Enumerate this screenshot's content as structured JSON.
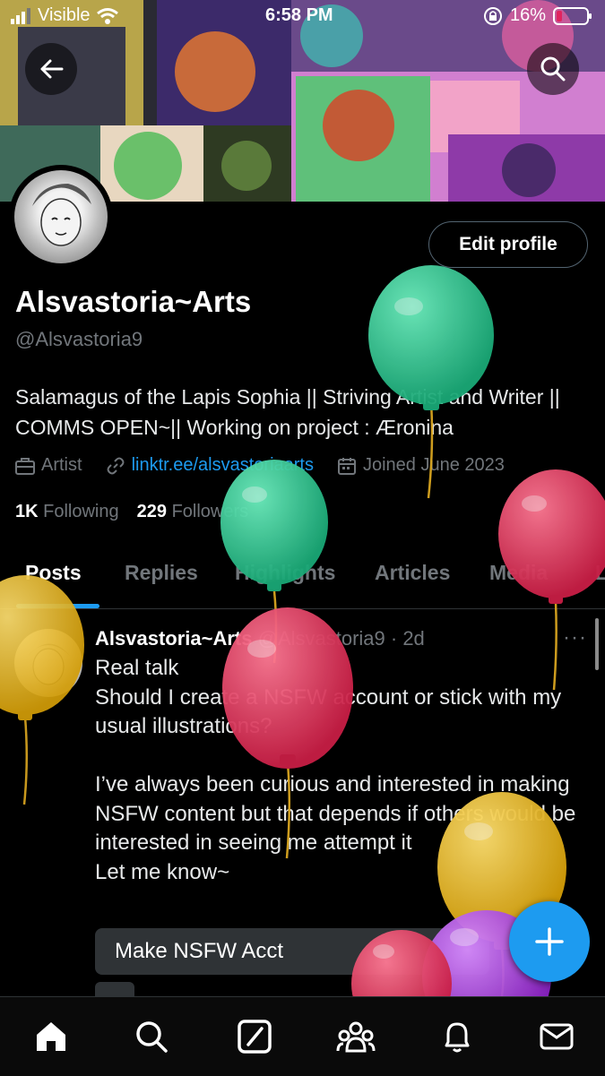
{
  "status_bar": {
    "carrier": "Visible",
    "time": "6:58 PM",
    "battery": "16%"
  },
  "profile": {
    "display_name": "Alsvastoria~Arts",
    "handle": "@Alsvastoria9",
    "bio": "Salamagus of the Lapis Sophia || Striving Artist and Writer || COMMS OPEN~|| Working on project : Æronina",
    "category": "Artist",
    "link": "linktr.ee/alsvastoriaarts",
    "joined": "Joined June 2023",
    "following_count": "1K",
    "following_label": "Following",
    "followers_count": "229",
    "followers_label": "Followers",
    "edit_button": "Edit profile"
  },
  "tabs": [
    {
      "label": "Posts",
      "active": true
    },
    {
      "label": "Replies"
    },
    {
      "label": "Highlights"
    },
    {
      "label": "Articles"
    },
    {
      "label": "Media"
    },
    {
      "label": "L"
    }
  ],
  "post": {
    "author": "Alsvastoria~Arts",
    "meta": "@Alsvastoria9 · 2d",
    "more": "···",
    "lines": [
      "Real talk",
      "Should I create a NSFW account or stick with my usual illustrations?",
      "",
      "I’ve always been curious and interested in making NSFW content but that depends if others would be interested in seeing me attempt it",
      "Let me know~"
    ],
    "poll_option_1": "Make NSFW Acct"
  },
  "nav": [
    "home-icon",
    "search-icon",
    "grok-icon",
    "communities-icon",
    "notifications-icon",
    "messages-icon"
  ],
  "colors": {
    "accent": "#1d9bf0",
    "balloon_green": "#2ecf92",
    "balloon_red": "#e3375b",
    "balloon_yellow": "#e8bd1c",
    "balloon_purple": "#a93ce0"
  }
}
